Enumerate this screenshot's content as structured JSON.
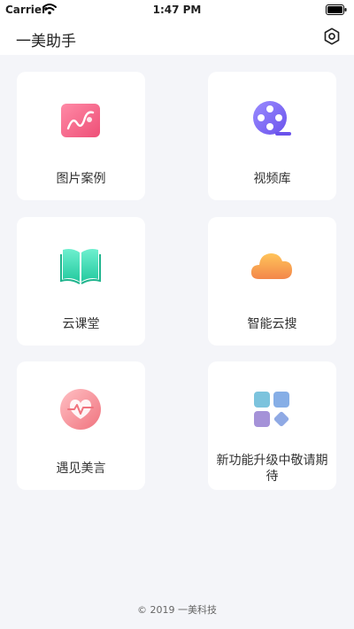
{
  "status_bar": {
    "carrier": "Carrier",
    "time": "1:47 PM"
  },
  "header": {
    "title": "一美助手",
    "settings_icon": "settings-gear-icon"
  },
  "tiles": [
    {
      "label": "图片案例",
      "icon": "picture-icon",
      "color": "#f05a7e"
    },
    {
      "label": "视频库",
      "icon": "video-reel-icon",
      "color": "#7d6cf0"
    },
    {
      "label": "云课堂",
      "icon": "book-icon",
      "color": "#3ed8b4"
    },
    {
      "label": "智能云搜",
      "icon": "cloud-icon",
      "color": "#f8a94a"
    },
    {
      "label": "遇见美言",
      "icon": "heartbeat-icon",
      "color": "#f48a92"
    },
    {
      "label": "新功能升级中敬请期待",
      "icon": "app-grid-icon",
      "color": "#86aee6"
    }
  ],
  "footer": {
    "copyright": "© 2019 一美科技"
  }
}
